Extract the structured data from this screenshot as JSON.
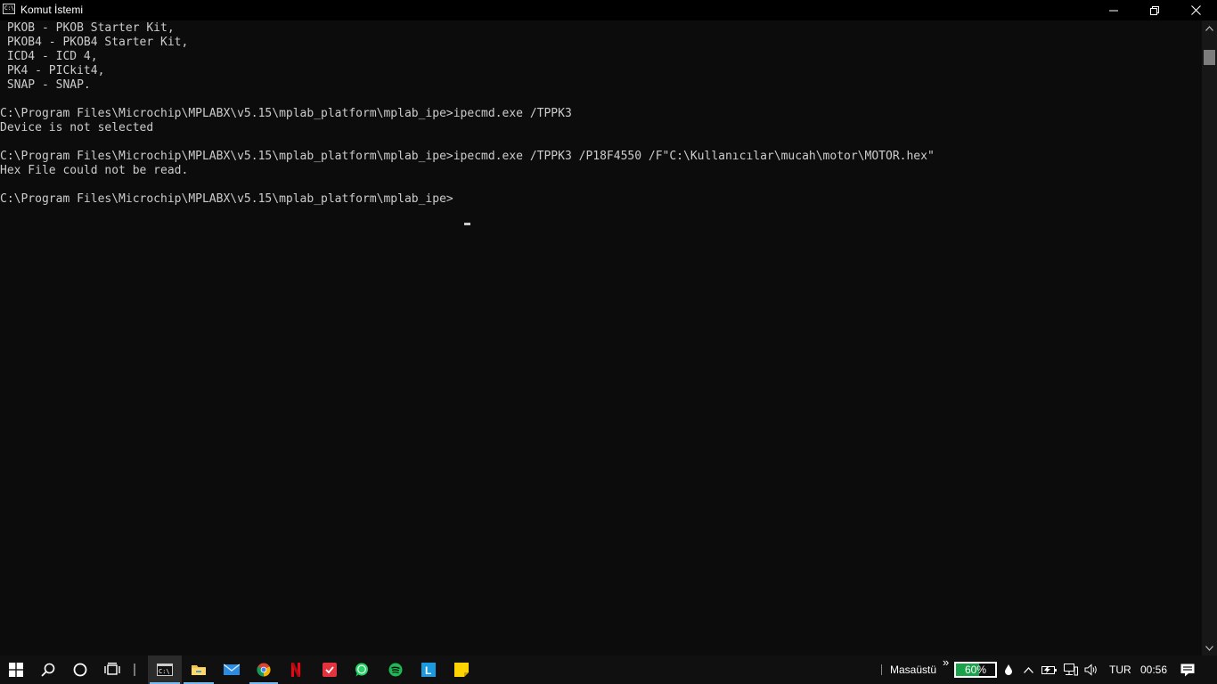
{
  "window": {
    "title": "Komut İstemi",
    "app_icon_text": "C:\\."
  },
  "console": {
    "lines": [
      " PKOB - PKOB Starter Kit,",
      " PKOB4 - PKOB4 Starter Kit,",
      " ICD4 - ICD 4,",
      " PK4 - PICkit4,",
      " SNAP - SNAP.",
      "",
      "C:\\Program Files\\Microchip\\MPLABX\\v5.15\\mplab_platform\\mplab_ipe>ipecmd.exe /TPPK3",
      "Device is not selected",
      "",
      "C:\\Program Files\\Microchip\\MPLABX\\v5.15\\mplab_platform\\mplab_ipe>ipecmd.exe /TPPK3 /P18F4550 /F\"C:\\Kullanıcılar\\mucah\\motor\\MOTOR.hex\"",
      "Hex File could not be read.",
      "",
      "C:\\Program Files\\Microchip\\MPLABX\\v5.15\\mplab_platform\\mplab_ipe>"
    ]
  },
  "taskbar": {
    "desktop_label": "Masaüstü",
    "overflow_label": "»",
    "battery_percent": 60,
    "battery_label": "60%",
    "language": "TUR",
    "time": "00:56",
    "apps": [
      {
        "name": "command-prompt",
        "icon": "cmd-icon",
        "active": true
      },
      {
        "name": "file-explorer",
        "icon": "folder-icon",
        "active": false
      },
      {
        "name": "mail",
        "icon": "mail-icon",
        "active": false
      },
      {
        "name": "chrome",
        "icon": "chrome-icon",
        "active": false
      },
      {
        "name": "netflix",
        "icon": "netflix-icon",
        "active": false
      },
      {
        "name": "red-app",
        "icon": "red-app-icon",
        "active": false
      },
      {
        "name": "whatsapp",
        "icon": "whatsapp-icon",
        "active": false
      },
      {
        "name": "spotify",
        "icon": "spotify-icon",
        "active": false
      },
      {
        "name": "l-app",
        "icon": "l-app-icon",
        "active": false
      },
      {
        "name": "sticky-notes",
        "icon": "sticky-notes-icon",
        "active": false
      }
    ]
  },
  "colors": {
    "console_bg": "#0c0c0c",
    "console_text": "#cccccc",
    "taskbar_bg": "#101010",
    "battery_green": "#1aa24a",
    "accent_underline": "#76b9ed"
  }
}
